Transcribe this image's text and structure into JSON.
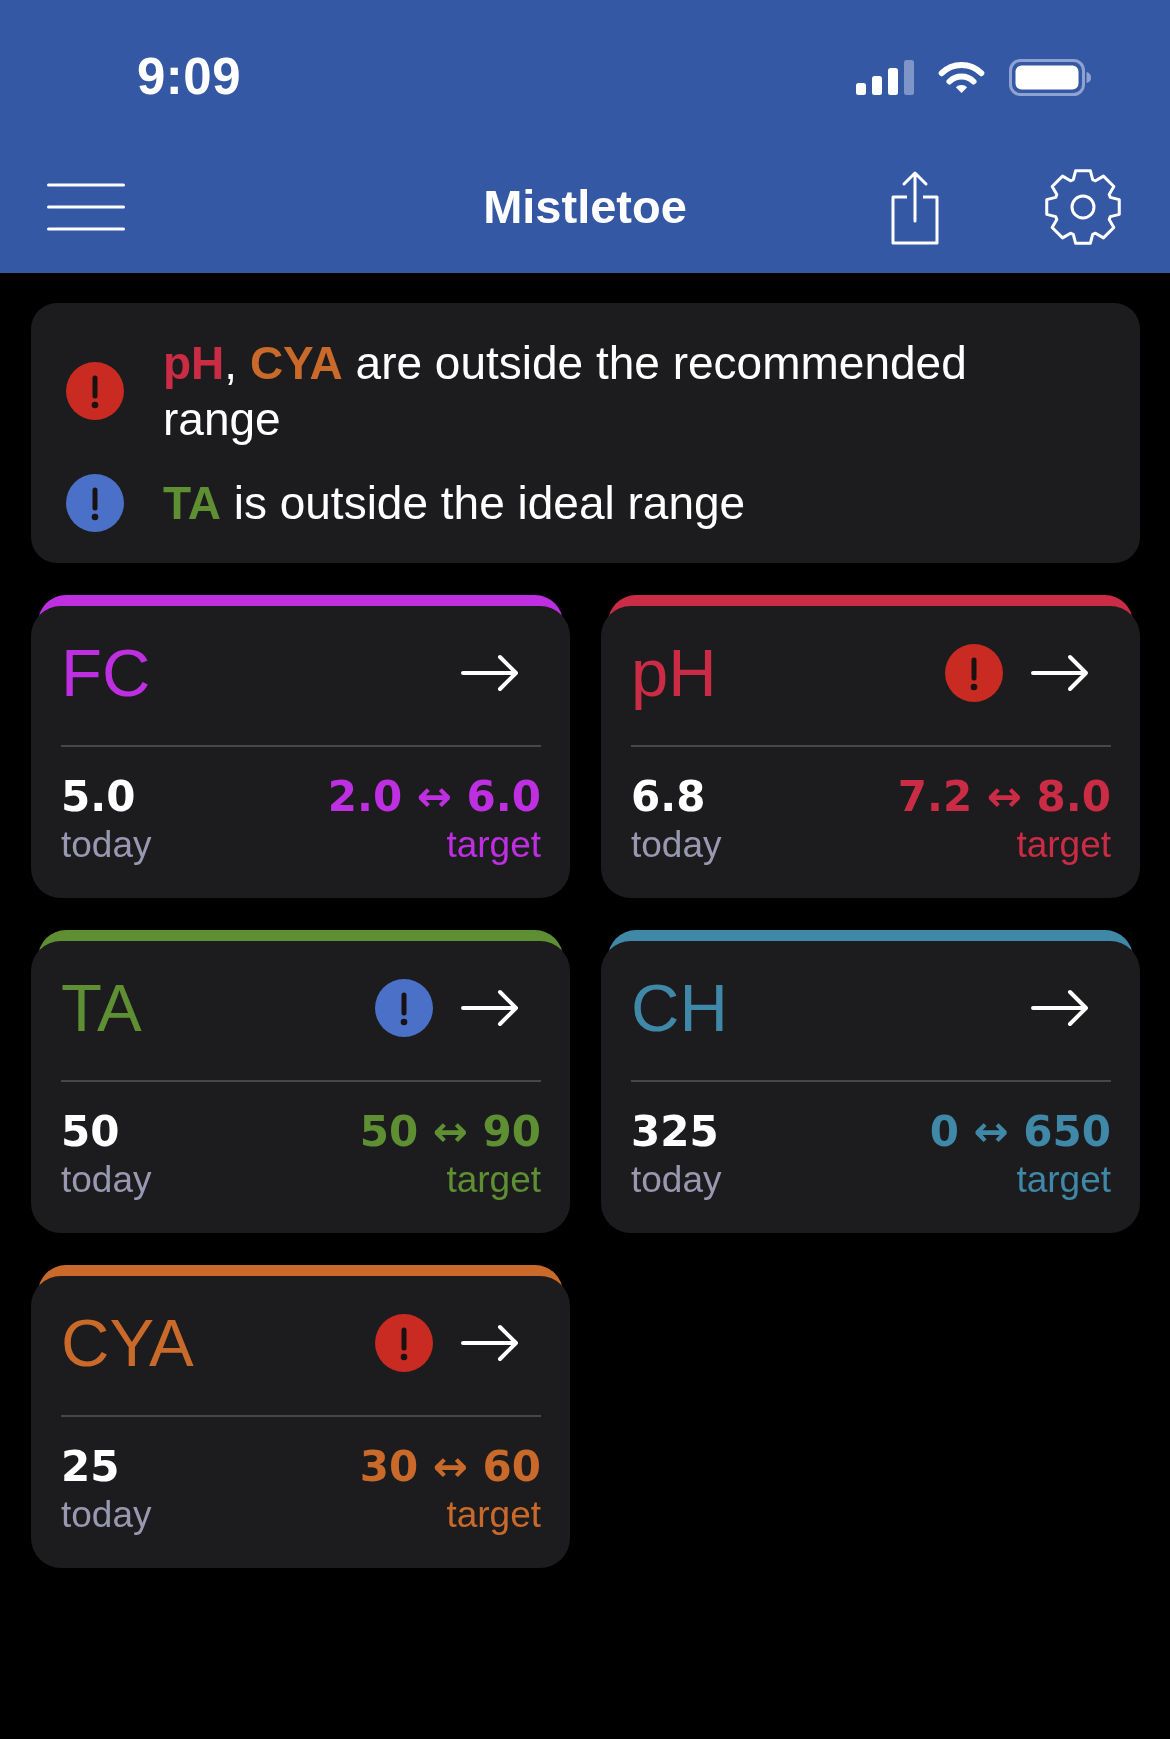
{
  "status_bar": {
    "time": "9:09"
  },
  "nav_bar": {
    "title": "Mistletoe"
  },
  "alerts": [
    {
      "kind": "outside_recommended",
      "segments": [
        {
          "text": "pH",
          "color": "#c92c44"
        },
        {
          "text": ", "
        },
        {
          "text": "CYA",
          "color": "#c96a2b"
        },
        {
          "text": " are outside the recommended range"
        }
      ]
    },
    {
      "kind": "outside_ideal",
      "segments": [
        {
          "text": "TA",
          "color": "#5f8f33"
        },
        {
          "text": " is outside the ideal range"
        }
      ]
    }
  ],
  "cards": [
    {
      "name": "FC",
      "color": "#bd2fe0",
      "value": "5.0",
      "value_label": "today",
      "target": "2.0 ↔ 6.0",
      "target_label": "target"
    },
    {
      "name": "pH",
      "color": "#c92c44",
      "alert": {
        "kind": "outside_recommended"
      },
      "value": "6.8",
      "value_label": "today",
      "target": "7.2 ↔ 8.0",
      "target_label": "target"
    },
    {
      "name": "TA",
      "color": "#5f8f33",
      "alert": {
        "kind": "outside_ideal"
      },
      "value": "50",
      "value_label": "today",
      "target": "50 ↔ 90",
      "target_label": "target"
    },
    {
      "name": "CH",
      "color": "#3f88a8",
      "value": "325",
      "value_label": "today",
      "target": "0 ↔ 650",
      "target_label": "target"
    },
    {
      "name": "CYA",
      "color": "#c96a2b",
      "alert": {
        "kind": "outside_recommended"
      },
      "value": "25",
      "value_label": "today",
      "target": "30 ↔ 60",
      "target_label": "target"
    }
  ]
}
